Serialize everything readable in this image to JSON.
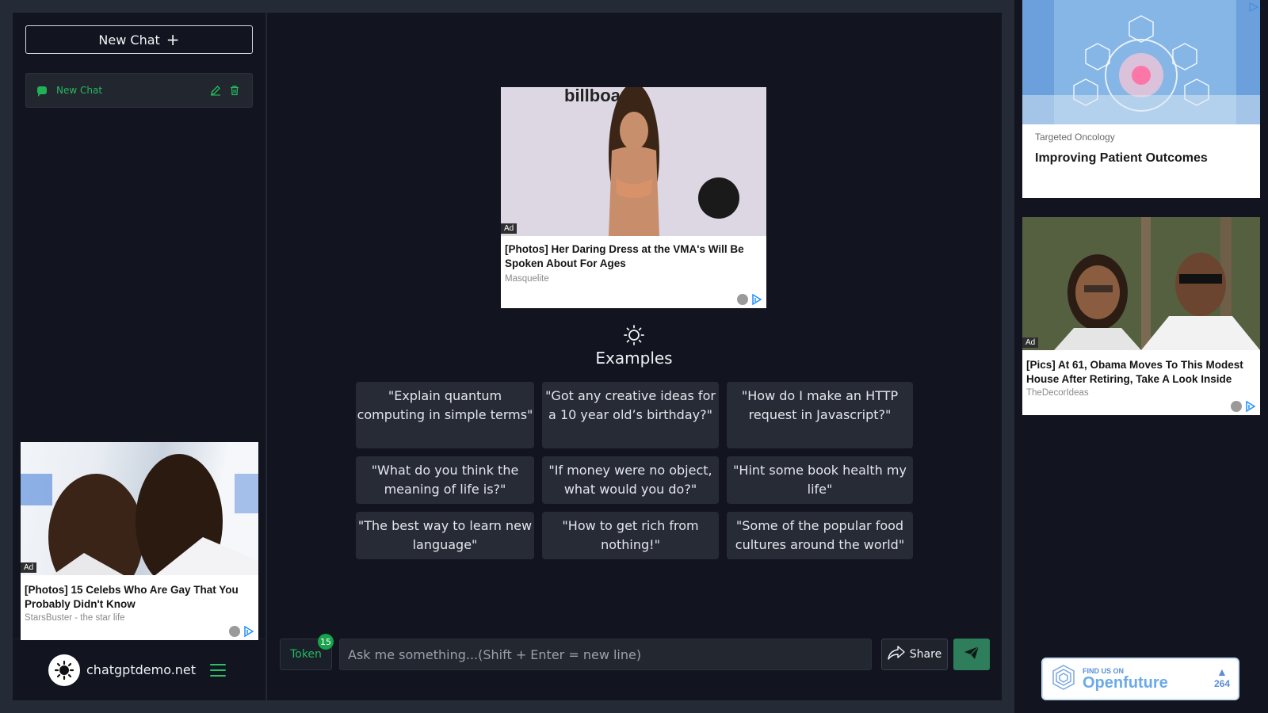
{
  "sidebar": {
    "new_chat_label": "New Chat",
    "chat_item_label": "New Chat",
    "site_name": "chatgptdemo.net"
  },
  "ads": {
    "left": {
      "tag": "Ad",
      "title": "[Photos] 15 Celebs Who Are Gay That You Probably Didn't Know",
      "source": "StarsBuster - the star life"
    },
    "center": {
      "tag": "Ad",
      "title": "[Photos] Her Daring Dress at the VMA's Will Be Spoken About For Ages",
      "source": "Masquelite"
    },
    "right1": {
      "source": "Targeted Oncology",
      "title": "Improving Patient Outcomes"
    },
    "right2": {
      "tag": "Ad",
      "title": "[Pics] At 61, Obama Moves To This Modest House After Retiring, Take A Look Inside",
      "source": "TheDecorIdeas"
    }
  },
  "main": {
    "examples_title": "Examples",
    "examples": [
      "\"Explain quantum computing in simple terms\"",
      "\"Got any creative ideas for a 10 year old’s birthday?\"",
      "\"How do I make an HTTP request in Javascript?\"",
      "\"What do you think the meaning of life is?\"",
      "\"If money were no object, what would you do?\"",
      "\"Hint some book health my life\"",
      "\"The best way to learn new language\"",
      "\"How to get rich from nothing!\"",
      "\"Some of the popular food cultures around the world\""
    ]
  },
  "input_bar": {
    "token_label": "Token",
    "token_count": "15",
    "placeholder": "Ask me something...(Shift + Enter = new line)",
    "share_label": "Share"
  },
  "openfuture": {
    "find_label": "FIND US ON",
    "name": "Openfuture",
    "votes": "264"
  },
  "colors": {
    "accent_green": "#22b85e",
    "send_button": "#2e7e5c",
    "panel_bg": "#12141f"
  }
}
